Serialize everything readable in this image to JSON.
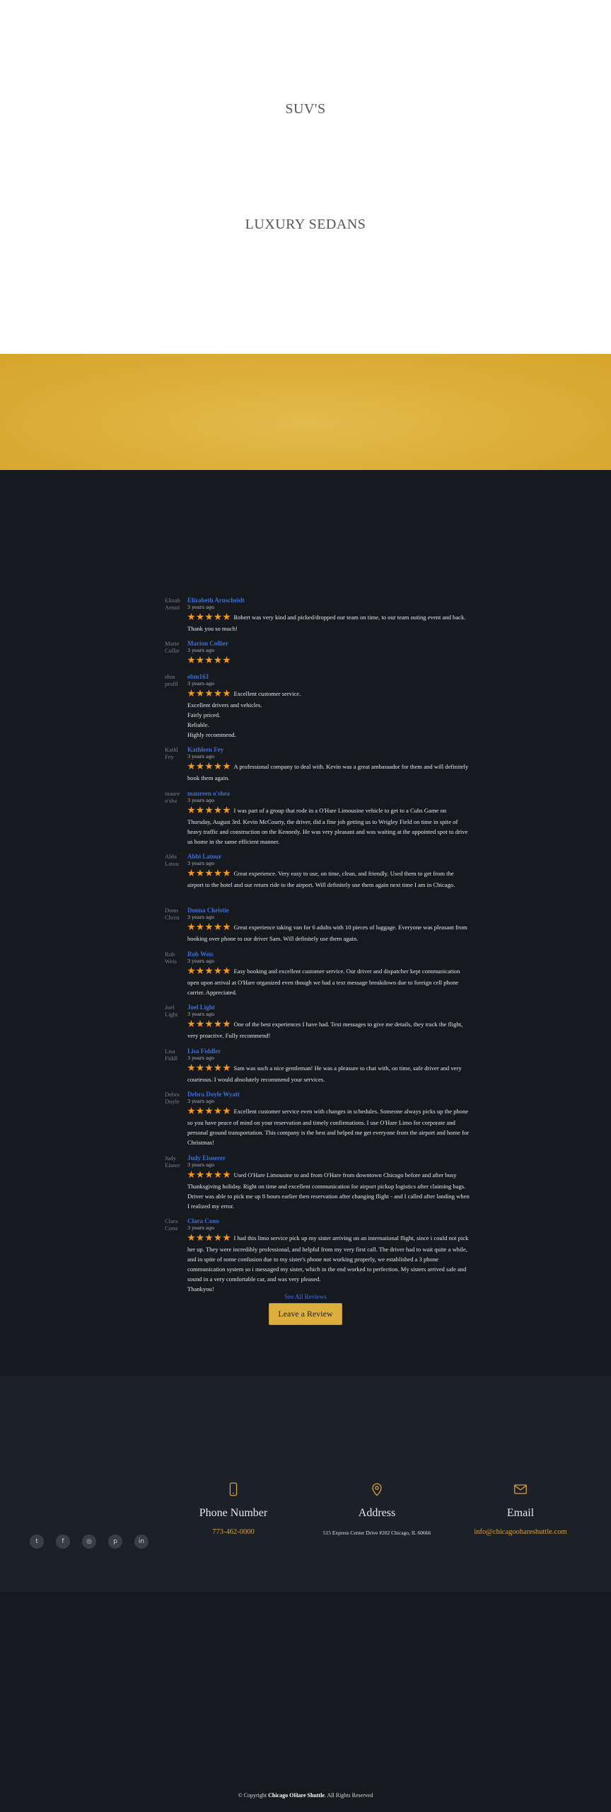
{
  "vehicles": {
    "suv": "SUV'S",
    "sedan": "LUXURY SEDANS"
  },
  "reviews": [
    {
      "avatar": "Elizab Arnsti",
      "name": "Elizabeth Arnscheidt",
      "time": "3 years ago",
      "stars": 5,
      "text": "Robert was very kind and picked/dropped our team on time, to our team outing event and back. Thank you so much!"
    },
    {
      "avatar": "Marie Collie",
      "name": "Marion Collier",
      "time": "3 years ago",
      "stars": 5,
      "text": ""
    },
    {
      "avatar": "ebm profil",
      "name": "ebm163",
      "time": "3 years ago",
      "stars": 5,
      "text": "Excellent customer service.\nExcellent drivers and vehicles.\nFairly priced.\nReliable.\nHighly recommend."
    },
    {
      "avatar": "Kathl Fey",
      "name": "Kathleen Fey",
      "time": "3 years ago",
      "stars": 5,
      "text": "A professional company to deal with. Kevin was a great ambassador for them and will definitely book them again."
    },
    {
      "avatar": "maure o'sha",
      "name": "maureen o'shea",
      "time": "3 years ago",
      "stars": 5,
      "text": "I was part of a group that rode in a O'Hare Limousine  vehicle to get to a Cubs Game on Thursday, August 3rd.  Kevin McCourty, the driver, did a fine job getting us to Wrigley Field on time in spite of heavy traffic and construction on the Kennedy.  He was very pleasant and was waiting at the appointed spot to drive us home in the same efficient manner."
    },
    {
      "avatar": "Abbi Latou",
      "name": "Abbi Latour",
      "time": "3 years ago",
      "stars": 5,
      "text": "Great experience. Very easy to use, on time, clean, and friendly. Used them to get from the airport to the hotel and our return ride to the airport. Will definitely use them again next time I am in Chicago."
    },
    {
      "avatar": "Donn Christ",
      "name": "Donna Christie",
      "time": "3 years ago",
      "stars": 5,
      "text": "Great experience taking van for 6 adults with 10 pieces of luggage. Everyone was pleasant from booking over phone to our driver Sam.  Will definitely use them again."
    },
    {
      "avatar": "Rob Weis",
      "name": "Rob Weis",
      "time": "3 years ago",
      "stars": 5,
      "text": "Easy booking and excellent customer service. Our driver and dispatcher kept communication open upon arrival at O'Hare organized even though we had a text message breakdown due to foreign cell phone carrier. Appreciated."
    },
    {
      "avatar": "Joel Light",
      "name": "Joel Light",
      "time": "3 years ago",
      "stars": 5,
      "text": "One of the best experiences I have had. Text messages to give me details, they track the flight, very proactive. Fully recommend!"
    },
    {
      "avatar": "Lisa Fiddl",
      "name": "Lisa Fiddler",
      "time": "3 years ago",
      "stars": 5,
      "text": "Sam was such a nice gentleman! He was a pleasure to chat with, on time, safe driver and very courteous. I would absolutely recommend your services."
    },
    {
      "avatar": "Debra Doyle",
      "name": "Debra Doyle Wyatt",
      "time": "3 years ago",
      "stars": 5,
      "text": "Excellent customer service even with changes in schedules.  Someone always picks up the phone so you have peace of mind on your reservation and timely confirmations.  I use O'Hare Limo for corporate and personal ground transportation.  This company is the best and helped me get everyone from the airport and home for Christmas!"
    },
    {
      "avatar": "Judy Eisner",
      "name": "Judy Eisnerer",
      "time": "3 years ago",
      "stars": 5,
      "text": "Used O'Hare Limousine to and from O'Hare from downtown Chicago before and after busy Thanksgiving holiday. Right on time and excellent communication for airport pickup logistics after claiming bags. Driver was able to pick me up 8 hours earlier then reservation after changing flight - and I called after landing when I realized my error."
    },
    {
      "avatar": "Clara Cono",
      "name": "Clara Cono",
      "time": "3 years ago",
      "stars": 5,
      "text": "I had this limo service pick up my sister arriving on an international flight, since i could not pick her up. They were incredibly professional, and helpful from my very first call. The driver had to wait quite a while, and in spite of some confusion due to my sister's phone not working properly, we established a 3 phone communication system so i messaged my sister,  which in the end worked  to perfection. My sisters arrived safe and sound in a very comfortable car, and was very pleased.\nThankyou!"
    }
  ],
  "see_all": "See All Reviews",
  "leave_review": "Leave a Review",
  "social": [
    {
      "icon": "twitter-icon",
      "glyph": "t"
    },
    {
      "icon": "facebook-icon",
      "glyph": "f"
    },
    {
      "icon": "instagram-icon",
      "glyph": "◎"
    },
    {
      "icon": "pinterest-icon",
      "glyph": "p"
    },
    {
      "icon": "linkedin-icon",
      "glyph": "in"
    }
  ],
  "contact": {
    "phone": {
      "title": "Phone Number",
      "value": "773-462-0000"
    },
    "address": {
      "title": "Address",
      "value": "515 Express Center Drive #202 Chicago, IL 60666"
    },
    "email": {
      "title": "Email",
      "value": "info@chicagoohareshuttle.com"
    }
  },
  "copyright": {
    "prefix": "© Copyright",
    "company": "Chicago OHare Shuttle",
    "suffix": ". All Rights Reserved"
  },
  "colors": {
    "gold": "#dcae3d",
    "link": "#3d6fd8",
    "star": "#f39a1a",
    "dark": "#16191d"
  }
}
